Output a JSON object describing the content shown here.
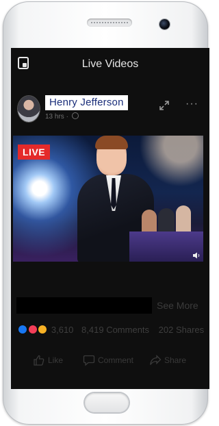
{
  "topbar": {
    "title": "Live Videos"
  },
  "post": {
    "author_name": "Henry Jefferson",
    "time_meta": "13 hrs · ",
    "more_label": "···"
  },
  "video": {
    "live_label": "LIVE"
  },
  "description": {
    "see_more_label": "See More"
  },
  "stats": {
    "reaction_count": "3,610",
    "comments": "8,419 Comments",
    "shares": "202 Shares"
  },
  "actions": {
    "like_label": "Like",
    "comment_label": "Comment",
    "share_label": "Share"
  },
  "colors": {
    "screen_bg": "#0f0f0f",
    "live_badge": "#e42a2a",
    "name_text": "#1a2e7a"
  }
}
